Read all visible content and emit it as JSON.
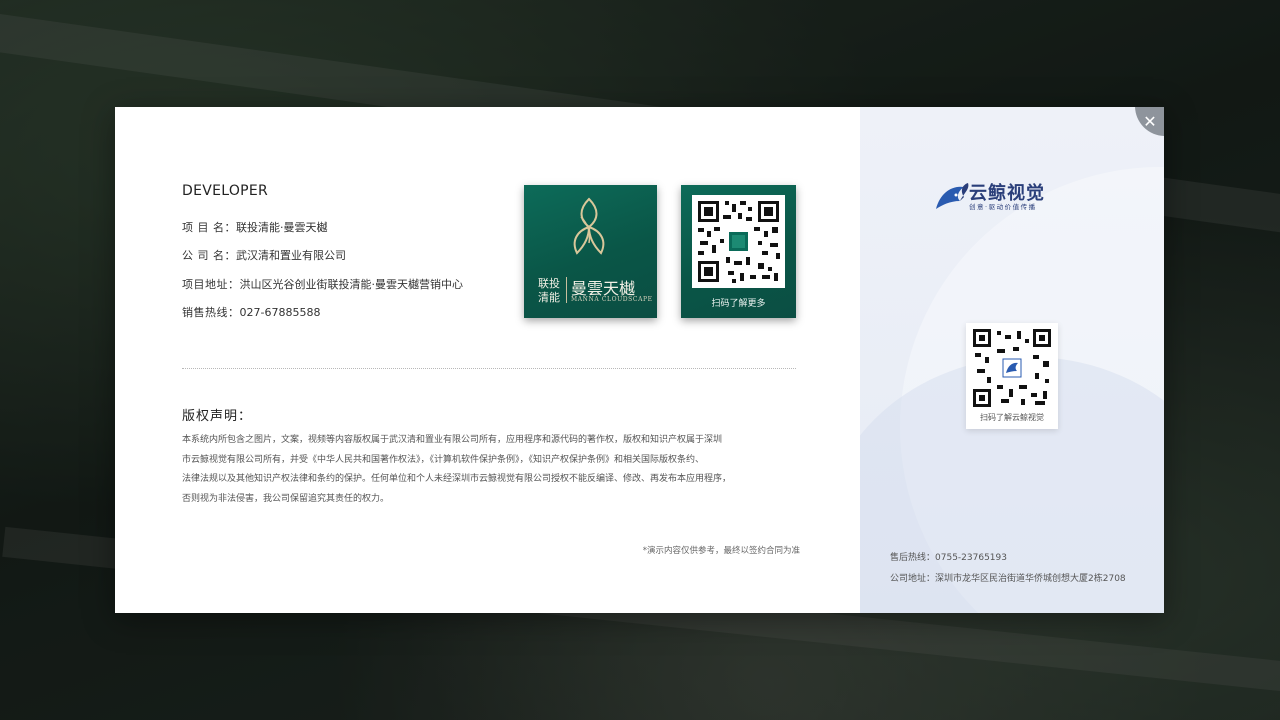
{
  "developer": {
    "title": "DEVELOPER",
    "rows": [
      {
        "label": "项 目 名：",
        "value": "联投清能·曼雲天樾"
      },
      {
        "label": "公 司 名：",
        "value": "武汉清和置业有限公司"
      },
      {
        "label": "项目地址：",
        "value": "洪山区光谷创业街联投清能·曼雲天樾营销中心"
      },
      {
        "label": "销售热线：",
        "value": "027-67885588"
      }
    ]
  },
  "project_card": {
    "brand_a_line1": "联投",
    "brand_a_line2": "清能",
    "brand_b": "曼雲天樾",
    "brand_en": "MANNA CLOUDSCAPE"
  },
  "qr_card": {
    "caption": "扫码了解更多"
  },
  "copyright": {
    "title": "版权声明：",
    "lines": [
      "本系统内所包含之图片，文案，视频等内容版权属于武汉清和置业有限公司所有，应用程序和源代码的著作权，版权和知识产权属于深圳",
      "市云鲸视觉有限公司所有，并受《中华人民共和国著作权法》，《计算机软件保护条例》，《知识产权保护条例》和相关国际版权条约、",
      "法律法规以及其他知识产权法律和条约的保护。任何单位和个人未经深圳市云鲸视觉有限公司授权不能反编译、修改、再发布本应用程序，",
      "否则视为非法侵害，我公司保留追究其责任的权力。"
    ],
    "note": "*演示内容仅供参考，最终以签约合同为准"
  },
  "vendor": {
    "name": "云鲸视觉",
    "slogan": "创意·驱动价值传播",
    "qr_caption": "扫码了解云鲸视觉",
    "hotline_label": "售后热线：",
    "hotline": "0755-23765193",
    "address_label": "公司地址：",
    "address": "深圳市龙华区民治街道华侨城创想大厦2栋2708"
  },
  "close_button": {
    "label": "✕"
  },
  "colors": {
    "card_green": "#0a5647",
    "brand_blue": "#2a3e7a",
    "accent_gold": "#c7bf9e"
  }
}
